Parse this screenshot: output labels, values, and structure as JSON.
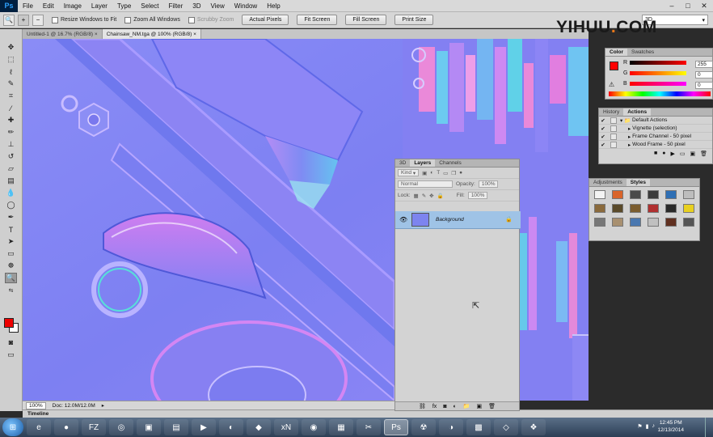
{
  "app": {
    "logo": "Ps"
  },
  "menu": [
    "File",
    "Edit",
    "Image",
    "Layer",
    "Type",
    "Select",
    "Filter",
    "3D",
    "View",
    "Window",
    "Help"
  ],
  "window_controls": {
    "minimize": "–",
    "maximize": "□",
    "close": "✕"
  },
  "options_bar": {
    "resize_windows": "Resize Windows to Fit",
    "zoom_all_windows": "Zoom All Windows",
    "scrubby_zoom": "Scrubby Zoom",
    "actual_pixels": "Actual Pixels",
    "fit_screen": "Fit Screen",
    "fill_screen": "Fill Screen",
    "print_size": "Print Size",
    "workspace": "3D"
  },
  "watermark": {
    "left": "YIHUU",
    "dot": ".",
    "right": "COM"
  },
  "doc_tabs": [
    {
      "label": "Untitled-1 @ 16.7% (RGB/8)",
      "close": "×"
    },
    {
      "label": "Chainsaw_NM.tga @ 100% (RGB/8)",
      "close": "×"
    }
  ],
  "status": {
    "zoom": "100%",
    "doc": "Doc: 12.0M/12.0M"
  },
  "timeline": "Timeline",
  "color_panel": {
    "tabs": [
      "Color",
      "Swatches"
    ],
    "channels": [
      {
        "label": "R",
        "value": "255"
      },
      {
        "label": "G",
        "value": "0"
      },
      {
        "label": "B",
        "value": "0"
      }
    ],
    "fg_color": "#ff0000"
  },
  "history_panel": {
    "tabs": [
      "History",
      "Actions"
    ],
    "rows": [
      {
        "label": "Default Actions"
      },
      {
        "label": "Vignette (selection)"
      },
      {
        "label": "Frame Channel - 50 pixel"
      },
      {
        "label": "Wood Frame - 50 pixel"
      }
    ]
  },
  "layers_panel": {
    "tabs": [
      "3D",
      "Layers",
      "Channels"
    ],
    "kind": "Kind",
    "blend_mode": "Normal",
    "opacity_label": "Opacity:",
    "opacity": "100%",
    "lock_label": "Lock:",
    "fill_label": "Fill:",
    "fill": "100%",
    "layer_name": "Background"
  },
  "styles_panel": {
    "tabs": [
      "Adjustments",
      "Styles"
    ],
    "swatches": [
      "#f3f3f3",
      "#d9642a",
      "#4a4a4a",
      "#3b3b3b",
      "#2f6fb4",
      "#bdbdbd",
      "#8a6a3c",
      "#5a4a2a",
      "#7b5d2f",
      "#b03030",
      "#2a2a2a",
      "#e8d020",
      "#777777",
      "#a89070",
      "#4a78b0",
      "#c0c0c0",
      "#603020",
      "#555555"
    ]
  },
  "taskbar": {
    "start": "⊞",
    "apps": [
      "e",
      "●",
      "FZ",
      "◎",
      "▣",
      "▤",
      "▶",
      "◐",
      "◆",
      "xN",
      "◉",
      "▦",
      "✂",
      "Ps",
      "☢",
      "◑",
      "▩",
      "◇",
      "❖"
    ],
    "time": "12:45 PM",
    "date": "12/13/2014"
  }
}
